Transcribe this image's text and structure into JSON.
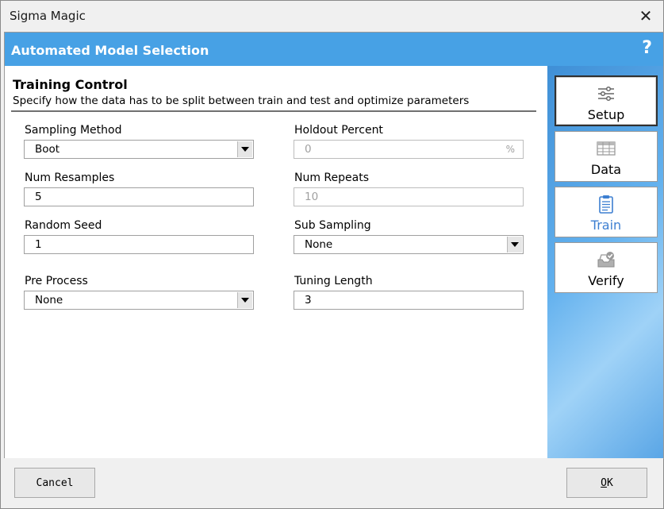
{
  "window": {
    "title": "Sigma Magic"
  },
  "header": {
    "title": "Automated Model Selection",
    "help": "?"
  },
  "section": {
    "title": "Training Control",
    "description": "Specify how the data has to be split between train and test and optimize parameters"
  },
  "fields": {
    "sampling_method": {
      "label": "Sampling Method",
      "value": "Boot"
    },
    "holdout_percent": {
      "label": "Holdout Percent",
      "value": "0",
      "suffix": "%"
    },
    "num_resamples": {
      "label": "Num Resamples",
      "value": "5"
    },
    "num_repeats": {
      "label": "Num Repeats",
      "value": "10"
    },
    "random_seed": {
      "label": "Random Seed",
      "value": "1"
    },
    "sub_sampling": {
      "label": "Sub Sampling",
      "value": "None"
    },
    "pre_process": {
      "label": "Pre Process",
      "value": "None"
    },
    "tuning_length": {
      "label": "Tuning Length",
      "value": "3"
    }
  },
  "nav": {
    "items": [
      {
        "label": "Setup",
        "icon": "sliders-icon"
      },
      {
        "label": "Data",
        "icon": "table-icon"
      },
      {
        "label": "Train",
        "icon": "clipboard-icon"
      },
      {
        "label": "Verify",
        "icon": "verify-icon"
      }
    ]
  },
  "footer": {
    "cancel_label": "Cancel",
    "ok_first": "O",
    "ok_rest": "K"
  },
  "colors": {
    "header": "#47a1e5",
    "train_accent": "#3d7fd1"
  }
}
